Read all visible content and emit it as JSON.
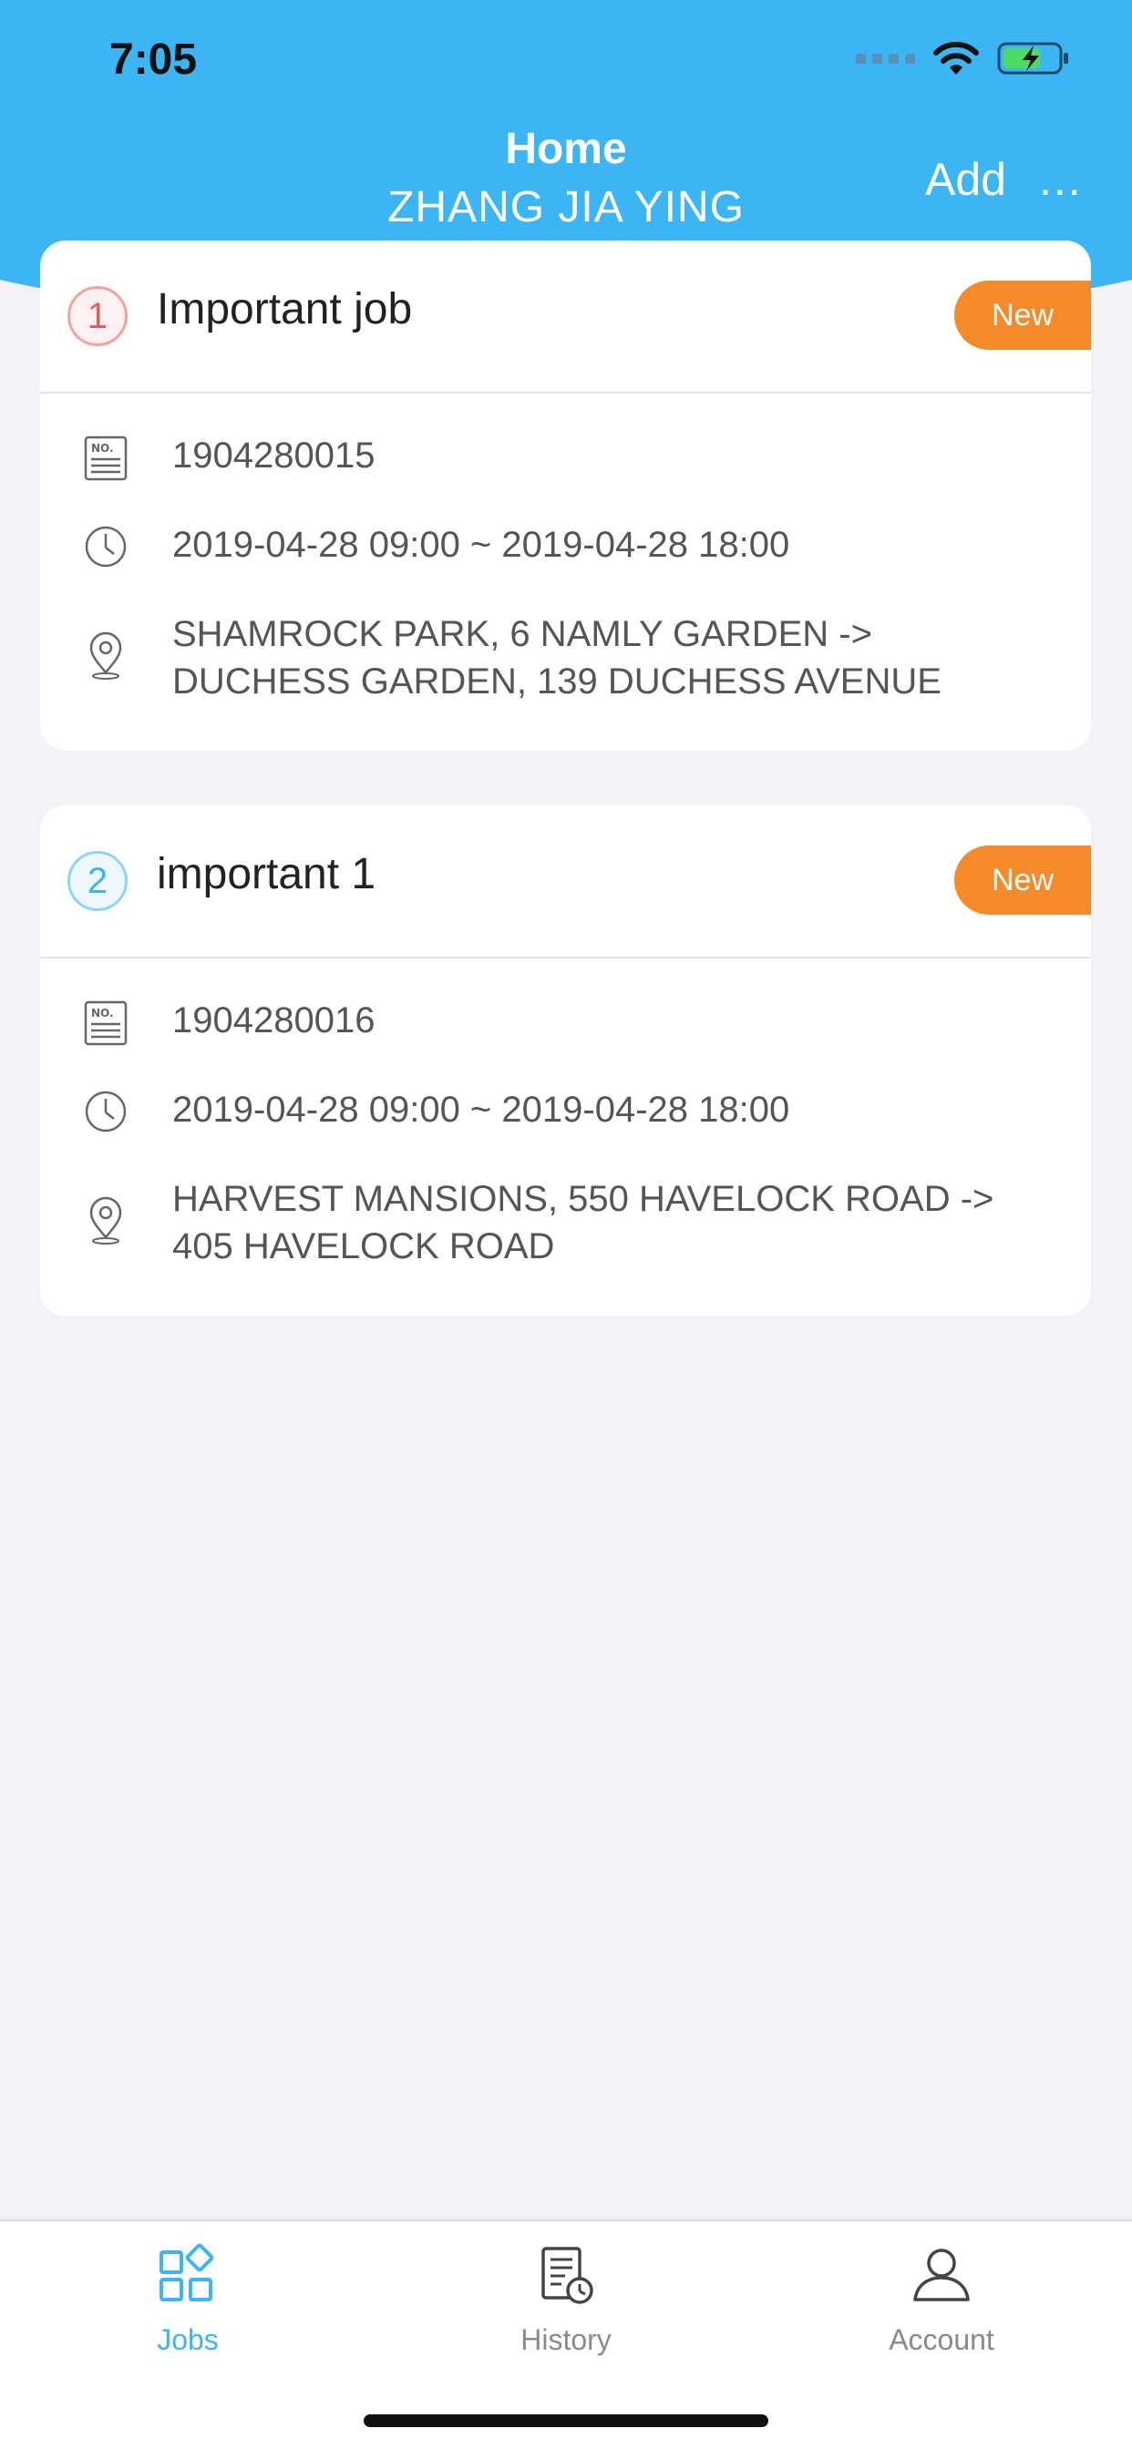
{
  "status_bar": {
    "time": "7:05"
  },
  "header": {
    "title": "Home",
    "subtitle": "ZHANG JIA YING",
    "add_label": "Add",
    "more_label": "..."
  },
  "jobs": [
    {
      "index": "1",
      "title": "Important job",
      "status": "New",
      "job_no": "1904280015",
      "time_range": "2019-04-28 09:00 ~ 2019-04-28 18:00",
      "route_line1": "SHAMROCK PARK, 6 NAMLY GARDEN ->",
      "route_line2": "DUCHESS GARDEN, 139 DUCHESS AVENUE"
    },
    {
      "index": "2",
      "title": "important 1",
      "status": "New",
      "job_no": "1904280016",
      "time_range": "2019-04-28 09:00 ~ 2019-04-28 18:00",
      "route_line1": "HARVEST MANSIONS, 550 HAVELOCK ROAD ->",
      "route_line2": "405 HAVELOCK ROAD"
    }
  ],
  "tabs": [
    {
      "label": "Jobs",
      "icon": "grid-icon",
      "active": true
    },
    {
      "label": "History",
      "icon": "history-doc-icon",
      "active": false
    },
    {
      "label": "Account",
      "icon": "person-icon",
      "active": false
    }
  ],
  "colors": {
    "header": "#3cb5f5",
    "status_new": "#f58a2b",
    "badge_red": "#e95a5a",
    "badge_blue": "#3cb5f5",
    "tab_active": "#3cb5f5"
  }
}
